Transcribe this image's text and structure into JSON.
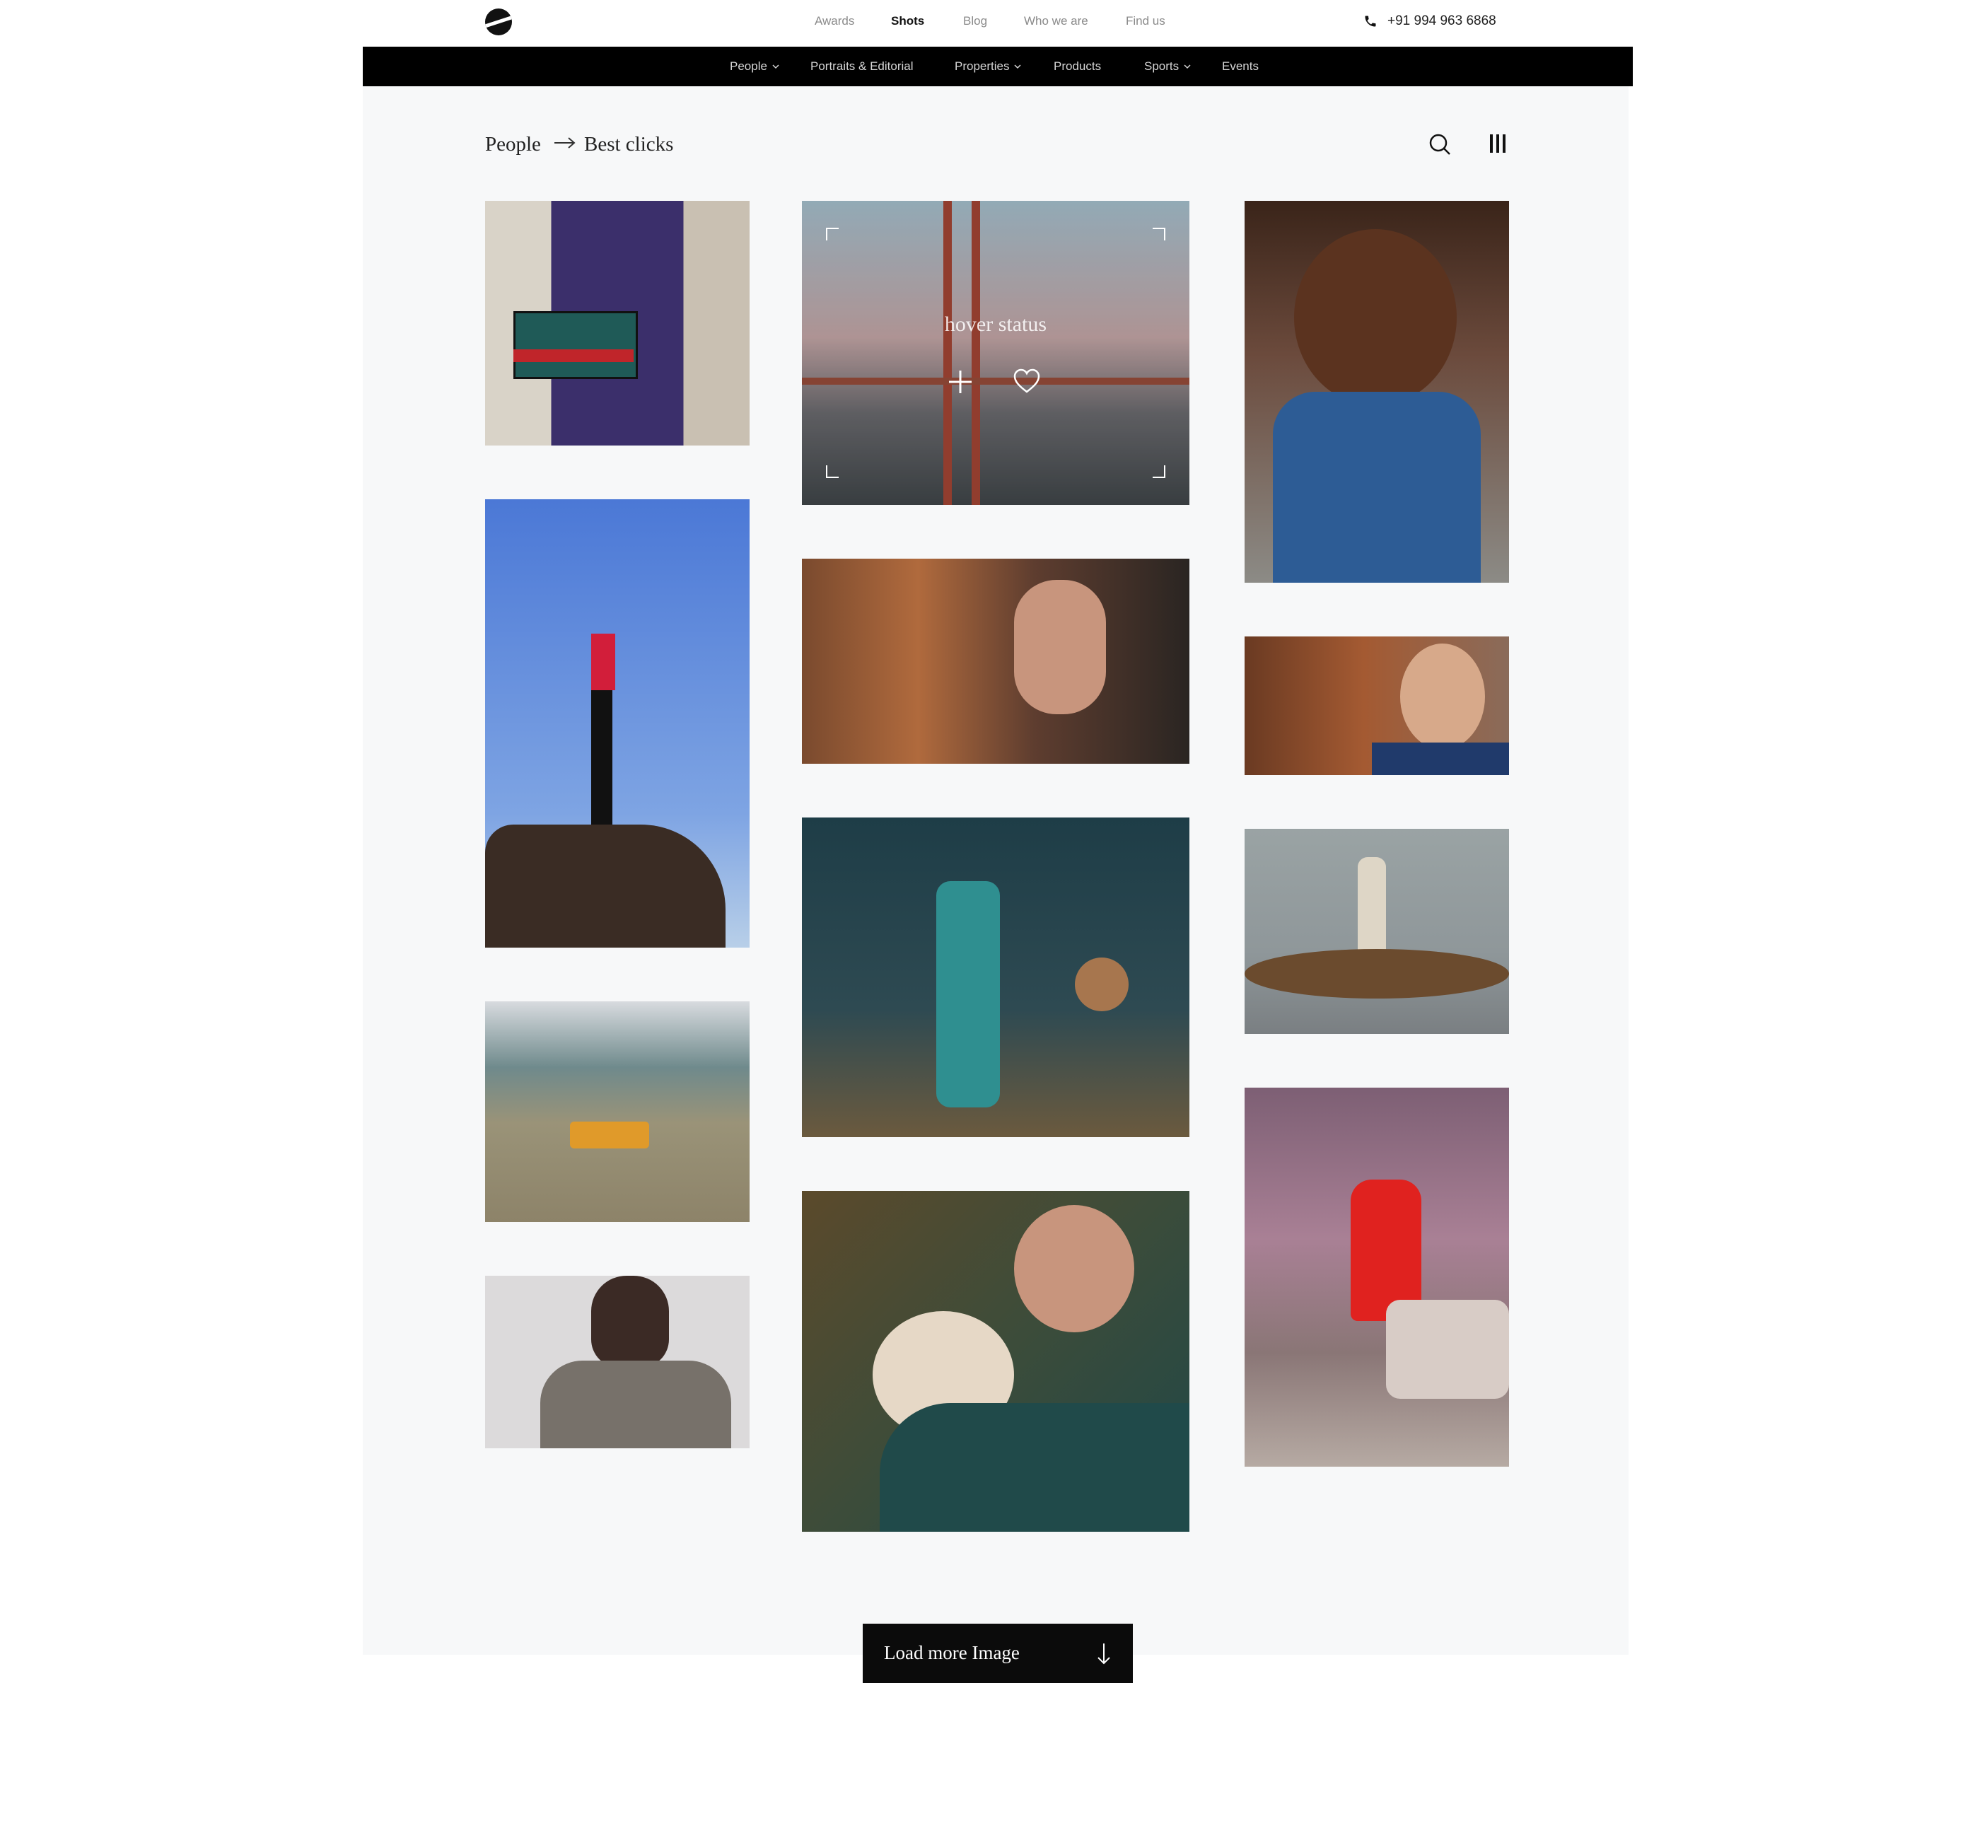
{
  "header": {
    "nav": [
      "Awards",
      "Shots",
      "Blog",
      "Who we are",
      "Find us"
    ],
    "active_nav": "Shots",
    "phone": "+91 994 963 6868"
  },
  "categories": [
    {
      "label": "People",
      "dropdown": true
    },
    {
      "label": "Portraits & Editorial",
      "dropdown": false
    },
    {
      "label": "Properties",
      "dropdown": true
    },
    {
      "label": "Products",
      "dropdown": false
    },
    {
      "label": "Sports",
      "dropdown": true
    },
    {
      "label": "Events",
      "dropdown": false
    }
  ],
  "breadcrumb": {
    "parent": "People",
    "current": "Best clicks"
  },
  "toolbar": {
    "icons": [
      "search-icon",
      "grid-view-icon"
    ]
  },
  "gallery": {
    "hover_label": "hover status",
    "hover_icons": [
      "plus-icon",
      "heart-icon"
    ]
  },
  "load_more": {
    "label": "Load more Image",
    "icon": "arrow-down-icon"
  },
  "colors": {
    "black_bar": "#000000",
    "panel_bg": "#f7f8f9",
    "button_bg": "#0b0b0b"
  }
}
